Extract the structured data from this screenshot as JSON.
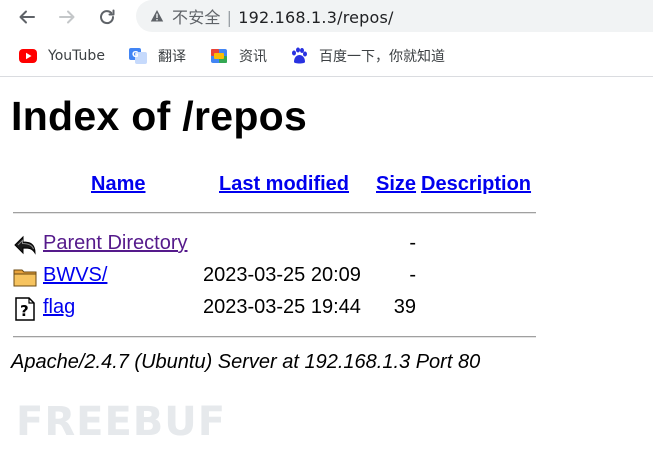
{
  "browser": {
    "security_label": "不安全",
    "separator": "|",
    "url": "192.168.1.3/repos/"
  },
  "bookmarks": [
    {
      "label": "YouTube",
      "icon": "youtube-icon"
    },
    {
      "label": "翻译",
      "icon": "translate-icon"
    },
    {
      "label": "资讯",
      "icon": "news-icon"
    },
    {
      "label": "百度一下，你就知道",
      "icon": "baidu-icon"
    }
  ],
  "page": {
    "title": "Index of /repos",
    "columns": {
      "name": "Name",
      "last_modified": "Last modified",
      "size": "Size",
      "description": "Description"
    },
    "rows": [
      {
        "name": "Parent Directory",
        "date": "",
        "size": "-",
        "icon": "back-arrow-icon"
      },
      {
        "name": "BWVS/",
        "date": "2023-03-25 20:09",
        "size": "-",
        "icon": "folder-icon"
      },
      {
        "name": "flag",
        "date": "2023-03-25 19:44",
        "size": "39",
        "icon": "unknown-file-icon"
      }
    ],
    "address": "Apache/2.4.7 (Ubuntu) Server at 192.168.1.3 Port 80"
  },
  "watermark": {
    "text": "FREEBUF"
  },
  "colors": {
    "link": "#0000ee",
    "visited": "#551a8b",
    "youtube": "#ff0000",
    "watermark": "#e6e9ec"
  }
}
